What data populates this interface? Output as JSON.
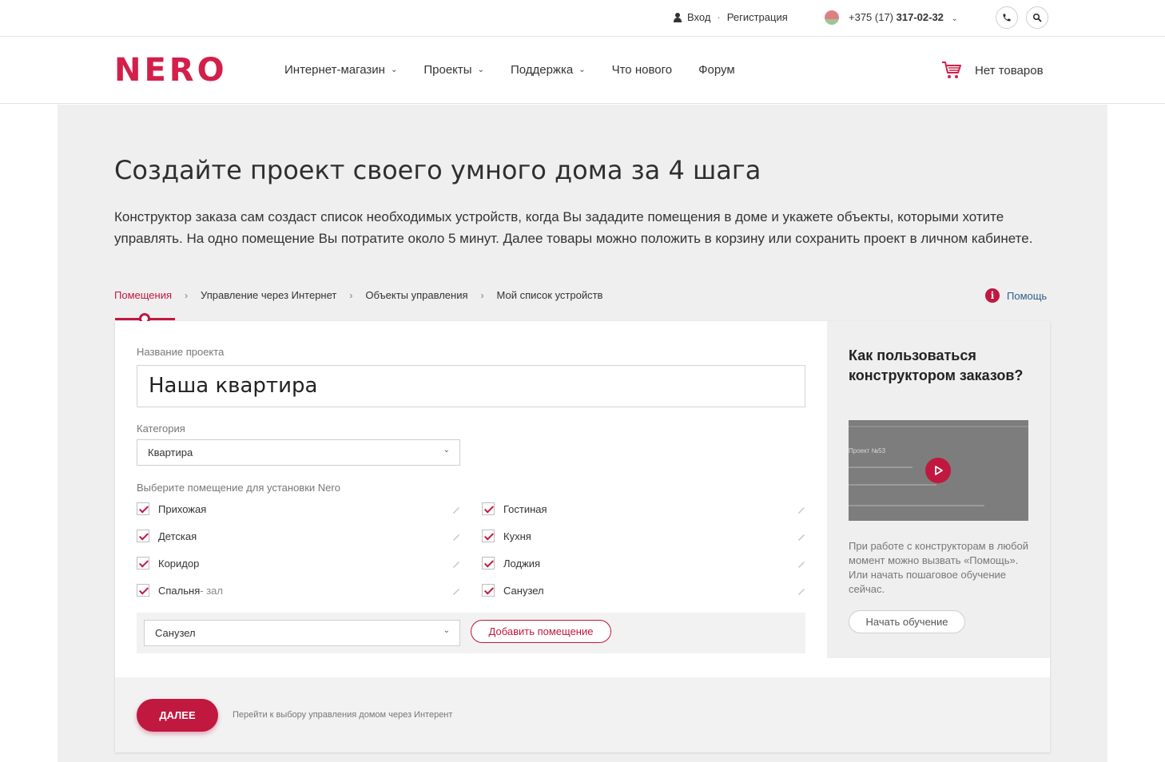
{
  "topbar": {
    "login": "Вход",
    "separator": "·",
    "register": "Регистрация",
    "phone_prefix": "+375 (17)",
    "phone_number": "317-02-32"
  },
  "header": {
    "logo": "NERO",
    "nav": [
      {
        "label": "Интернет-магазин",
        "dropdown": true
      },
      {
        "label": "Проекты",
        "dropdown": true
      },
      {
        "label": "Поддержка",
        "dropdown": true
      },
      {
        "label": "Что нового",
        "dropdown": false
      },
      {
        "label": "Форум",
        "dropdown": false
      }
    ],
    "cart_label": "Нет товаров"
  },
  "page": {
    "title": "Создайте проект своего умного дома за 4 шага",
    "description": "Конструктор заказа сам создаст список необходимых устройств, когда Вы зададите помещения в доме и укажете объекты, которыми хотите управлять. На одно помещение Вы потратите около 5 минут. Далее товары можно положить в корзину или сохранить проект в личном кабинете."
  },
  "steps": [
    "Помещения",
    "Управление через Интернет",
    "Объекты управления",
    "Мой список устройств"
  ],
  "help_label": "Помощь",
  "form": {
    "project_name_label": "Название проекта",
    "project_name_value": "Наша квартира",
    "category_label": "Категория",
    "category_value": "Квартира",
    "rooms_label": "Выберите помещение для установки Nero",
    "rooms_left": [
      {
        "name": "Прихожая",
        "sub": ""
      },
      {
        "name": "Детская",
        "sub": ""
      },
      {
        "name": "Коридор",
        "sub": ""
      },
      {
        "name": "Спальня",
        "sub": " - зал"
      }
    ],
    "rooms_right": [
      {
        "name": "Гостиная",
        "sub": ""
      },
      {
        "name": "Кухня",
        "sub": ""
      },
      {
        "name": "Лоджия",
        "sub": ""
      },
      {
        "name": "Санузел",
        "sub": ""
      }
    ],
    "add_room_select": "Санузел",
    "add_room_button": "Добавить помещение"
  },
  "sidebar": {
    "title": "Как пользоваться конструктором заказов?",
    "video_text": "Проект №53",
    "text": "При работе с конструкторам в любой момент можно вызвать «Помощь». Или начать пошаговое обучение сейчас.",
    "button": "Начать обучение"
  },
  "footer": {
    "next_button": "ДАЛЕЕ",
    "hint": "Перейти к выбору управления домом через Интерент"
  },
  "colors": {
    "accent": "#c0183f",
    "logo": "#d31f4a",
    "link": "#2f5f8a"
  }
}
